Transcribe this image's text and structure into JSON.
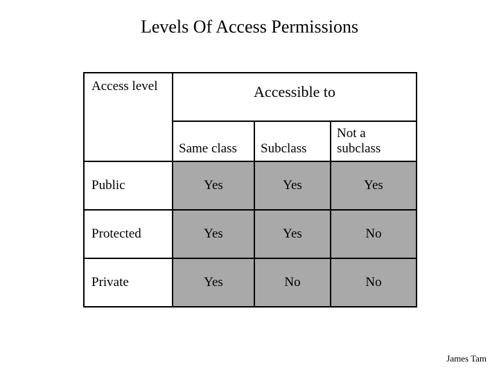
{
  "title": "Levels Of Access Permissions",
  "footer": "James Tam",
  "table": {
    "corner_label": "Access level",
    "accessible_to": "Accessible to",
    "columns": [
      "Same class",
      "Subclass",
      "Not a subclass"
    ],
    "rows": [
      {
        "label": "Public",
        "values": [
          "Yes",
          "Yes",
          "Yes"
        ]
      },
      {
        "label": "Protected",
        "values": [
          "Yes",
          "Yes",
          "No"
        ]
      },
      {
        "label": "Private",
        "values": [
          "Yes",
          "No",
          "No"
        ]
      }
    ]
  },
  "chart_data": {
    "type": "table",
    "title": "Levels Of Access Permissions",
    "column_group": "Accessible to",
    "row_header": "Access level",
    "columns": [
      "Same class",
      "Subclass",
      "Not a subclass"
    ],
    "rows": [
      "Public",
      "Protected",
      "Private"
    ],
    "values": [
      [
        "Yes",
        "Yes",
        "Yes"
      ],
      [
        "Yes",
        "Yes",
        "No"
      ],
      [
        "Yes",
        "No",
        "No"
      ]
    ]
  }
}
